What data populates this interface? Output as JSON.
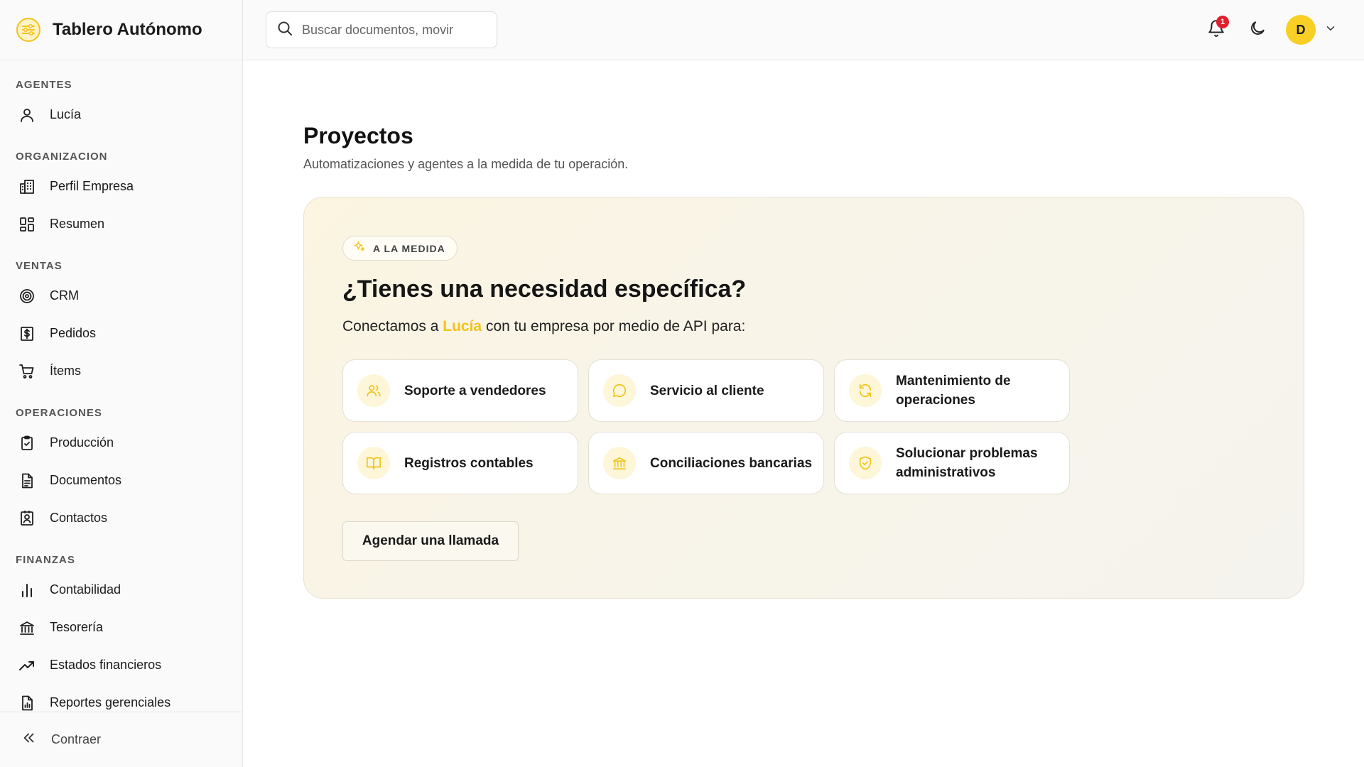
{
  "brand": {
    "title": "Tablero Autónomo",
    "accent": "#f7cf25"
  },
  "search": {
    "placeholder": "Buscar documentos, movir"
  },
  "topbar": {
    "notifications_count": "1",
    "avatar_initial": "D"
  },
  "sidebar": {
    "sections": [
      {
        "label": "AGENTES",
        "items": [
          {
            "label": "Lucía",
            "icon": "user-icon"
          }
        ]
      },
      {
        "label": "ORGANIZACION",
        "items": [
          {
            "label": "Perfil Empresa",
            "icon": "building-icon"
          },
          {
            "label": "Resumen",
            "icon": "dashboard-icon"
          }
        ]
      },
      {
        "label": "VENTAS",
        "items": [
          {
            "label": "CRM",
            "icon": "target-icon"
          },
          {
            "label": "Pedidos",
            "icon": "dollar-receipt-icon"
          },
          {
            "label": "Ítems",
            "icon": "cart-icon"
          }
        ]
      },
      {
        "label": "OPERACIONES",
        "items": [
          {
            "label": "Producción",
            "icon": "clipboard-check-icon"
          },
          {
            "label": "Documentos",
            "icon": "document-icon"
          },
          {
            "label": "Contactos",
            "icon": "contact-icon"
          }
        ]
      },
      {
        "label": "FINANZAS",
        "items": [
          {
            "label": "Contabilidad",
            "icon": "bar-chart-icon"
          },
          {
            "label": "Tesorería",
            "icon": "bank-icon"
          },
          {
            "label": "Estados financieros",
            "icon": "trend-up-icon"
          },
          {
            "label": "Reportes gerenciales",
            "icon": "report-icon"
          }
        ]
      }
    ],
    "collapse_label": "Contraer"
  },
  "main": {
    "title": "Proyectos",
    "subtitle": "Automatizaciones y agentes a la medida de tu operación.",
    "card": {
      "tag": "A LA MEDIDA",
      "title": "¿Tienes una necesidad específica?",
      "desc_prefix": "Conectamos a ",
      "desc_highlight": "Lucía",
      "desc_suffix": " con tu empresa por medio de API para:",
      "tiles": [
        {
          "label": "Soporte a vendedores",
          "icon": "users-icon"
        },
        {
          "label": "Servicio al cliente",
          "icon": "chat-bubble-icon"
        },
        {
          "label": "Mantenimiento de operaciones",
          "icon": "refresh-icon"
        },
        {
          "label": "Registros contables",
          "icon": "book-icon"
        },
        {
          "label": "Conciliaciones bancarias",
          "icon": "bank-icon"
        },
        {
          "label": "Solucionar problemas administrativos",
          "icon": "shield-check-icon"
        }
      ],
      "cta": "Agendar una llamada"
    }
  }
}
